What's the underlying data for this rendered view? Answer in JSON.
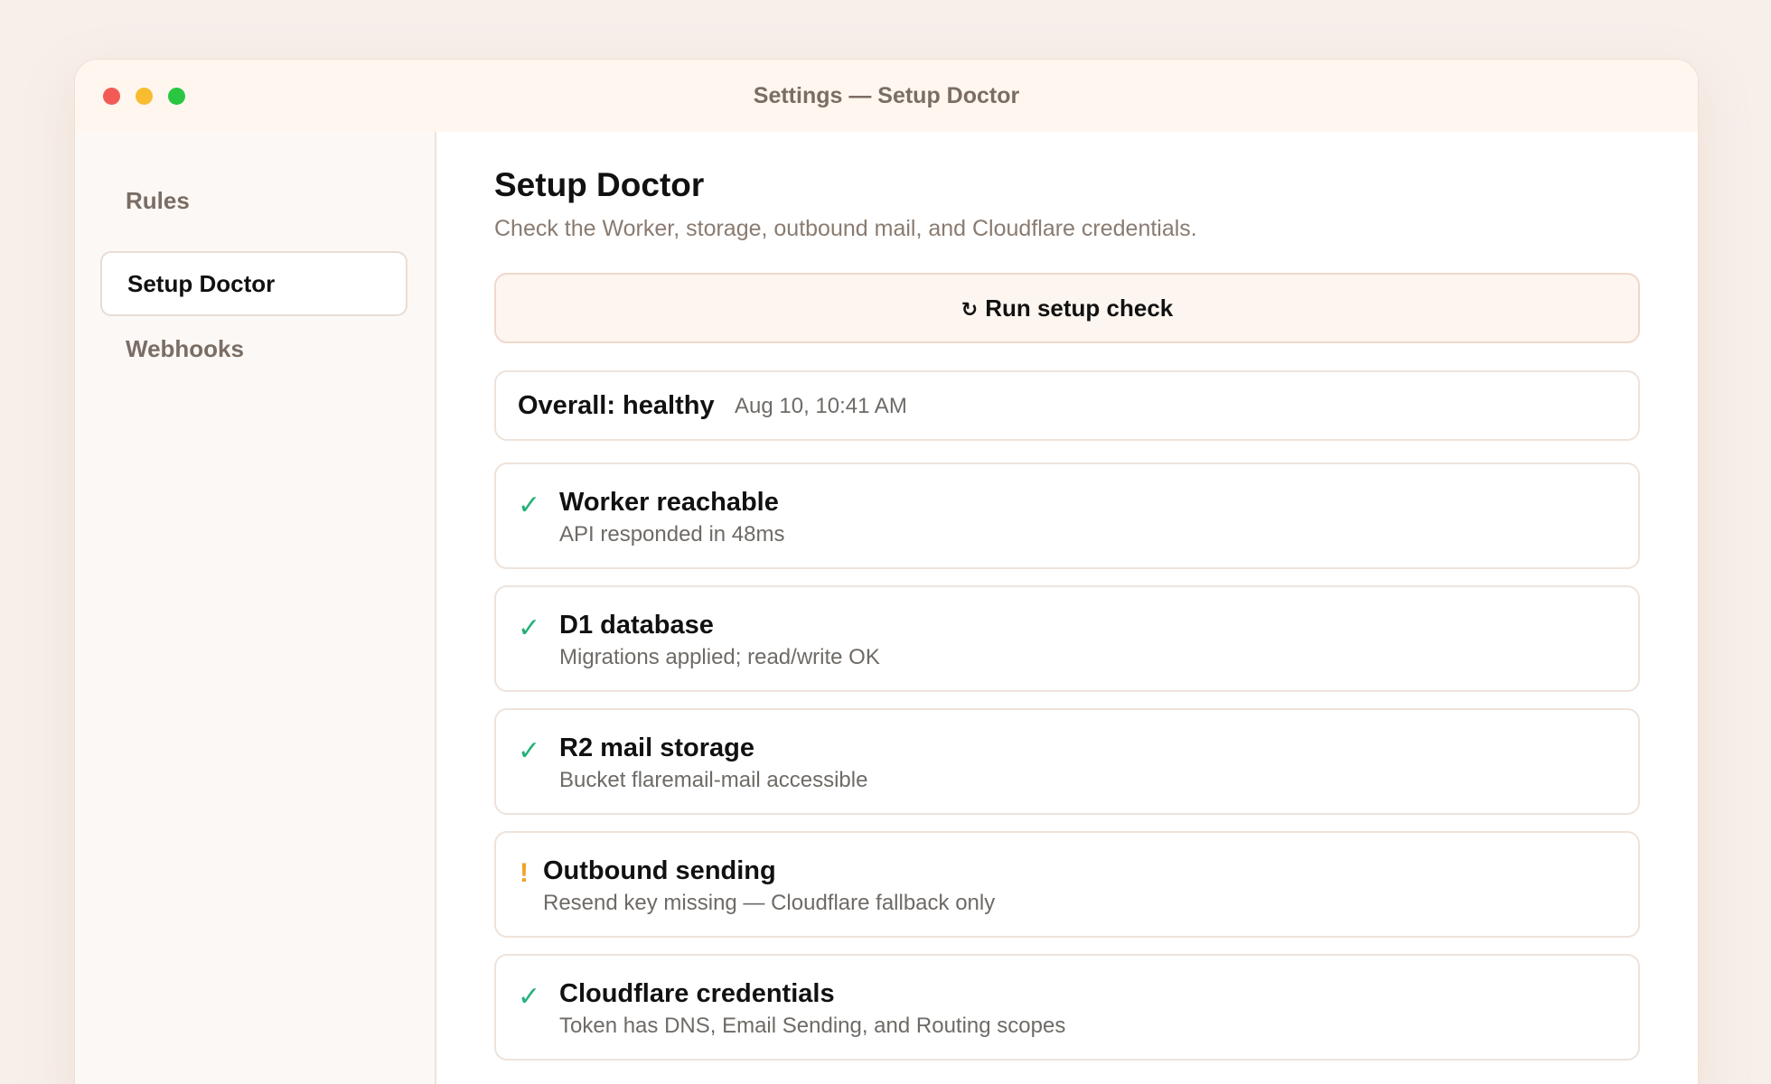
{
  "window": {
    "title": "Settings — Setup Doctor"
  },
  "sidebar": {
    "items": [
      {
        "label": "Rules",
        "active": false
      },
      {
        "label": "Setup Doctor",
        "active": true
      },
      {
        "label": "Webhooks",
        "active": false
      }
    ]
  },
  "main": {
    "title": "Setup Doctor",
    "subtitle": "Check the Worker, storage, outbound mail, and Cloudflare credentials.",
    "run_button": {
      "icon": "refresh-icon",
      "icon_glyph": "↻",
      "label": "Run setup check"
    },
    "overall": {
      "label": "Overall: healthy",
      "timestamp": "Aug 10, 10:41 AM"
    },
    "checks": [
      {
        "status": "ok",
        "icon": "check-icon",
        "glyph": "✓",
        "name": "Worker reachable",
        "detail": "API responded in 48ms"
      },
      {
        "status": "ok",
        "icon": "check-icon",
        "glyph": "✓",
        "name": "D1 database",
        "detail": "Migrations applied; read/write OK"
      },
      {
        "status": "ok",
        "icon": "check-icon",
        "glyph": "✓",
        "name": "R2 mail storage",
        "detail": "Bucket flaremail-mail accessible"
      },
      {
        "status": "warn",
        "icon": "warning-icon",
        "glyph": "!",
        "name": "Outbound sending",
        "detail": "Resend key missing — Cloudflare fallback only"
      },
      {
        "status": "ok",
        "icon": "check-icon",
        "glyph": "✓",
        "name": "Cloudflare credentials",
        "detail": "Token has DNS, Email Sending, and Routing scopes"
      }
    ]
  },
  "colors": {
    "ok": "#27b07a",
    "warn": "#f2a12b",
    "accent_bg": "#fdf5ef"
  }
}
